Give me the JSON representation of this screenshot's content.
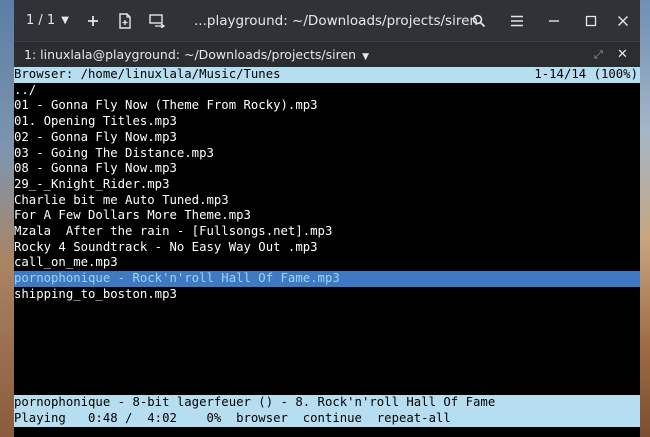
{
  "titlebar": {
    "counter": "1 / 1",
    "title": "...playground: ~/Downloads/projects/siren",
    "icons": [
      "chevron-down-icon",
      "plus-icon",
      "new-window-icon",
      "broadcast-icon",
      "search-icon",
      "hamburger-menu-icon",
      "minimize-icon",
      "maximize-icon",
      "close-icon"
    ]
  },
  "tab": {
    "label": "1: linuxlala@playground: ~/Downloads/projects/siren",
    "expand": "⤢",
    "close": "✕"
  },
  "browser": {
    "header_left": "Browser: /home/linuxlala/Music/Tunes",
    "header_right": "1-14/14 (100%)",
    "files": [
      "../",
      "01 - Gonna Fly Now (Theme From Rocky).mp3",
      "01. Opening Titles.mp3",
      "02 - Gonna Fly Now.mp3",
      "03 - Going The Distance.mp3",
      "08 - Gonna Fly Now.mp3",
      "29_-_Knight_Rider.mp3",
      "Charlie bit me Auto Tuned.mp3",
      "For A Few Dollars More Theme.mp3",
      "Mzala  After the rain - [Fullsongs.net].mp3",
      "Rocky 4 Soundtrack - No Easy Way Out .mp3",
      "call_on_me.mp3",
      "pornophonique - Rock'n'roll Hall Of Fame.mp3",
      "shipping_to_boston.mp3"
    ],
    "selected_index": 12
  },
  "status": {
    "track": "pornophonique - 8-bit lagerfeuer () - 8. Rock'n'roll Hall Of Fame",
    "playback": "Playing   0:48 /  4:02    0%  browser  continue  repeat-all"
  },
  "colors": {
    "bar_bg": "#b6def0",
    "selection_bg": "#3e79c4",
    "selection_fg": "#9fd4f0",
    "titlebar_bg": "#2f3337"
  }
}
